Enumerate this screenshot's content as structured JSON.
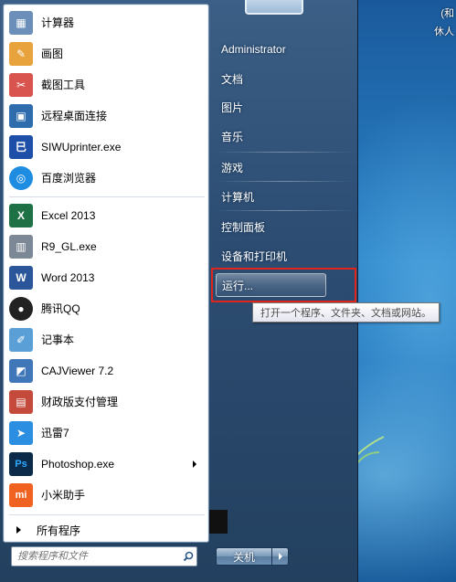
{
  "desktop": {
    "corner_text": [
      "(和",
      "休人"
    ]
  },
  "start_menu": {
    "programs": [
      {
        "label": "计算器",
        "icon": "calculator-icon",
        "color": "#6b8fb8",
        "glyph": "▦",
        "has_submenu": false
      },
      {
        "label": "画图",
        "icon": "paint-icon",
        "color": "#e8a33c",
        "glyph": "✎",
        "has_submenu": false
      },
      {
        "label": "截图工具",
        "icon": "snipping-tool-icon",
        "color": "#d9534f",
        "glyph": "✂",
        "has_submenu": false
      },
      {
        "label": "远程桌面连接",
        "icon": "remote-desktop-icon",
        "color": "#2f6cae",
        "glyph": "▣",
        "has_submenu": false
      },
      {
        "label": "SIWUprinter.exe",
        "icon": "siwuprinter-icon",
        "color": "#1d4ea8",
        "glyph": "巳",
        "has_submenu": false
      },
      {
        "label": "百度浏览器",
        "icon": "baidu-browser-icon",
        "color": "#1e8ce0",
        "glyph": "◎",
        "has_submenu": false
      },
      {
        "label": "Excel 2013",
        "icon": "excel-icon",
        "color": "#1e7145",
        "glyph": "X",
        "has_submenu": false
      },
      {
        "label": "R9_GL.exe",
        "icon": "r9-gl-icon",
        "color": "#7d8896",
        "glyph": "▥",
        "has_submenu": false
      },
      {
        "label": "Word 2013",
        "icon": "word-icon",
        "color": "#2b579a",
        "glyph": "W",
        "has_submenu": false
      },
      {
        "label": "腾讯QQ",
        "icon": "qq-penguin-icon",
        "color": "#222222",
        "glyph": "●",
        "has_submenu": false
      },
      {
        "label": "记事本",
        "icon": "notepad-icon",
        "color": "#5aa0d6",
        "glyph": "✐",
        "has_submenu": false
      },
      {
        "label": "CAJViewer 7.2",
        "icon": "cajviewer-icon",
        "color": "#4077b8",
        "glyph": "◩",
        "has_submenu": false
      },
      {
        "label": "财政版支付管理",
        "icon": "payment-manager-icon",
        "color": "#c44b3c",
        "glyph": "▤",
        "has_submenu": false
      },
      {
        "label": "迅雷7",
        "icon": "xunlei-icon",
        "color": "#2b8ee0",
        "glyph": "➤",
        "has_submenu": false
      },
      {
        "label": "Photoshop.exe",
        "icon": "photoshop-icon",
        "color": "#0b2a4a",
        "glyph": "Ps",
        "has_submenu": true
      },
      {
        "label": "小米助手",
        "icon": "xiaomi-assistant-icon",
        "color": "#f06222",
        "glyph": "mi",
        "has_submenu": false
      }
    ],
    "all_programs": "所有程序",
    "search": {
      "placeholder": "搜索程序和文件"
    },
    "right_items": [
      {
        "label": "Administrator",
        "name": "user-name"
      },
      {
        "label": "文档",
        "name": "documents"
      },
      {
        "label": "图片",
        "name": "pictures"
      },
      {
        "label": "音乐",
        "name": "music"
      },
      {
        "label": "游戏",
        "name": "games"
      },
      {
        "label": "计算机",
        "name": "computer"
      },
      {
        "label": "控制面板",
        "name": "control-panel"
      },
      {
        "label": "设备和打印机",
        "name": "devices-and-printers"
      },
      {
        "label": "运行...",
        "name": "run"
      }
    ],
    "tooltip": "打开一个程序、文件夹、文档或网站。",
    "shutdown_label": "关机"
  },
  "colors": {
    "highlight_border": "#e0261b",
    "menu_glass": "#2d4d73"
  }
}
